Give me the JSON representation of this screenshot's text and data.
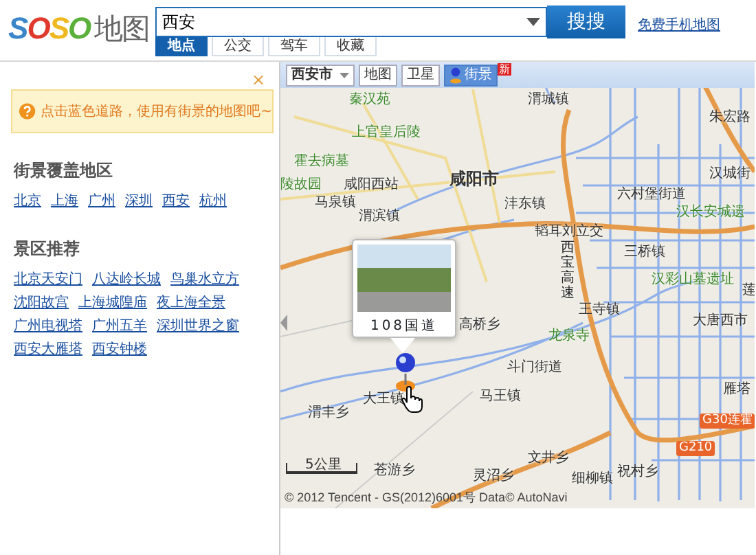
{
  "header": {
    "logo_letters": [
      "S",
      "O",
      "S",
      "O"
    ],
    "logo_suffix": "地图",
    "search": {
      "value": "西安"
    },
    "search_button": "搜搜",
    "mobile_link": "免费手机地图",
    "tabs": [
      {
        "label": "地点",
        "selected": true
      },
      {
        "label": "公交",
        "selected": false
      },
      {
        "label": "驾车",
        "selected": false
      },
      {
        "label": "收藏",
        "selected": false
      }
    ]
  },
  "sidebar": {
    "close": "×",
    "notice": "点击蓝色道路，使用有街景的地图吧~",
    "coverage_title": "街景覆盖地区",
    "coverage_links": [
      "北京",
      "上海",
      "广州",
      "深圳",
      "西安",
      "杭州"
    ],
    "scenic_title": "景区推荐",
    "scenic_links": [
      "北京天安门",
      "八达岭长城",
      "鸟巢水立方",
      "沈阳故宫",
      "上海城隍庙",
      "夜上海全景",
      "广州电视塔",
      "广州五羊",
      "深圳世界之窗",
      "西安大雁塔",
      "西安钟楼"
    ]
  },
  "map": {
    "city_select": "西安市",
    "view_tabs": [
      {
        "label": "地图",
        "selected": false,
        "new": false
      },
      {
        "label": "卫星",
        "selected": false,
        "new": false
      },
      {
        "label": "街景",
        "selected": true,
        "new": true
      }
    ],
    "new_badge": "新",
    "labels": [
      {
        "text": "渭城镇",
        "kind": "place"
      },
      {
        "text": "朱宏路",
        "kind": "place"
      },
      {
        "text": "秦汉苑",
        "kind": "poi"
      },
      {
        "text": "上官皇后陵",
        "kind": "poi"
      },
      {
        "text": "霍去病墓",
        "kind": "poi"
      },
      {
        "text": "陵故园",
        "kind": "poi"
      },
      {
        "text": "咸阳西站",
        "kind": "place"
      },
      {
        "text": "咸阳市",
        "kind": "city"
      },
      {
        "text": "马泉镇",
        "kind": "place"
      },
      {
        "text": "渭滨镇",
        "kind": "place"
      },
      {
        "text": "沣东镇",
        "kind": "place"
      },
      {
        "text": "六村堡街道",
        "kind": "place"
      },
      {
        "text": "汉城街",
        "kind": "place"
      },
      {
        "text": "汉长安城遗",
        "kind": "poi"
      },
      {
        "text": "韬耳刘立交",
        "kind": "place"
      },
      {
        "text": "三桥镇",
        "kind": "place"
      },
      {
        "text": "汉彩山墓遗址",
        "kind": "poi"
      },
      {
        "text": "莲",
        "kind": "place"
      },
      {
        "text": "王寺镇",
        "kind": "place"
      },
      {
        "text": "大唐西市",
        "kind": "place"
      },
      {
        "text": "高桥乡",
        "kind": "place"
      },
      {
        "text": "龙泉寺",
        "kind": "poi"
      },
      {
        "text": "斗门街道",
        "kind": "place"
      },
      {
        "text": "雁塔",
        "kind": "place"
      },
      {
        "text": "大王镇",
        "kind": "place"
      },
      {
        "text": "马王镇",
        "kind": "place"
      },
      {
        "text": "渭丰乡",
        "kind": "place"
      },
      {
        "text": "文井乡",
        "kind": "place"
      },
      {
        "text": "苍游乡",
        "kind": "place"
      },
      {
        "text": "灵沼乡",
        "kind": "place"
      },
      {
        "text": "细柳镇",
        "kind": "place"
      },
      {
        "text": "祝村乡",
        "kind": "place"
      },
      {
        "text": "G210",
        "kind": "route"
      },
      {
        "text": "G30连霍",
        "kind": "route"
      },
      {
        "text": "西宝高速",
        "kind": "vertical"
      }
    ],
    "popup_caption": "108国道",
    "scale": "5公里",
    "copyright": "© 2012 Tencent - GS(2012)6001号 Data© AutoNavi"
  }
}
